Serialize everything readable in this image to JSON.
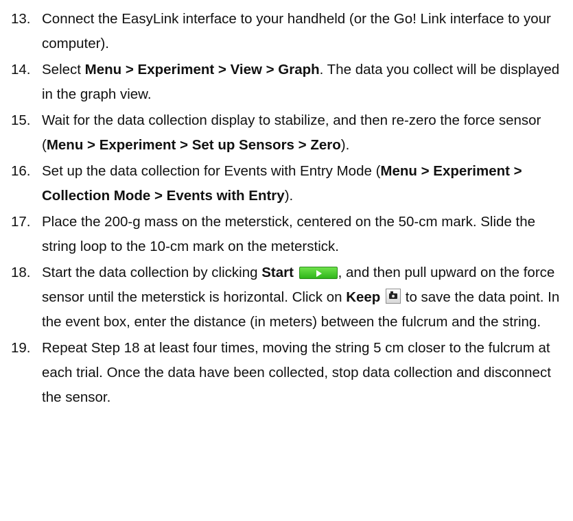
{
  "steps": [
    {
      "num": "13.",
      "text": "Connect the EasyLink interface to your handheld (or the Go! Link interface to your computer)."
    },
    {
      "num": "14.",
      "a": "Select ",
      "b1": "Menu > Experiment > View > Graph",
      "c": ". The data you collect will be displayed in the graph view."
    },
    {
      "num": "15.",
      "a": "Wait for the data collection display to stabilize, and then re-zero the force sensor (",
      "b1": "Menu > Experiment > Set up Sensors > Zero",
      "c": ")."
    },
    {
      "num": "16.",
      "a": "Set up the data collection for Events with Entry Mode (",
      "b1": "Menu > Experiment > Collection Mode > Events with Entry",
      "c": ")."
    },
    {
      "num": "17.",
      "text": "Place the 200-g mass on the meterstick, centered on the 50-cm mark. Slide the string loop to the 10-cm mark on the meterstick."
    },
    {
      "num": "18.",
      "a": "Start the data collection by clicking ",
      "b1": "Start",
      "c": ", and then pull upward on the force sensor until the meterstick is horizontal. Click on ",
      "b2": "Keep",
      "d": " to save the data point. In the event box, enter the distance (in meters) between the fulcrum and the string."
    },
    {
      "num": "19.",
      "text": "Repeat Step 18 at least four times, moving the string 5 cm closer to the fulcrum at each trial. Once the data have been collected, stop data collection and disconnect the sensor."
    }
  ],
  "icons": {
    "start": "play-icon",
    "keep": "camera-icon",
    "start_color": "#3cc22a"
  }
}
